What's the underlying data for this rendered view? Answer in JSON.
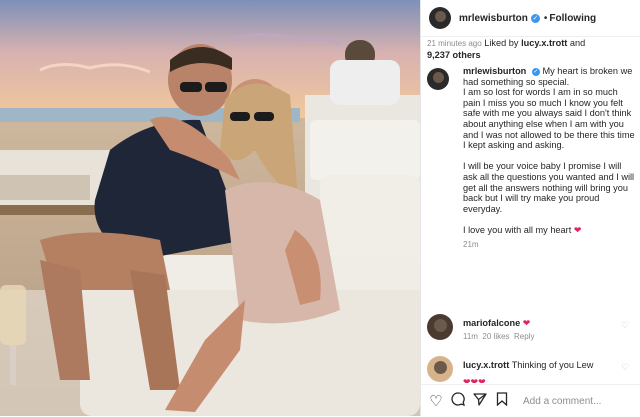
{
  "post": {
    "username": "mrlewisburton",
    "verified_mark": "✓",
    "follow_separator": "•",
    "follow_label": "Following",
    "time_ago": "21 minutes ago",
    "liked_by_prefix": "Liked by",
    "liked_by_user": "lucy.x.trott",
    "liked_by_suffix": "and",
    "liked_by_count": "9,237 others"
  },
  "caption": {
    "username": "mrlewisburton",
    "para1": "My heart is broken we had something so special.",
    "para2": "I am so lost for words I am in so much pain I miss you so much I know you felt safe with me you always said I don't think about anything else when I am with you and I was not allowed to be there this time I kept asking and asking.",
    "para3": "I will be your voice baby I promise I will ask all the questions you wanted and I will get all the answers nothing will bring you back but I will try make you proud everyday.",
    "para4": "I love you with all my heart",
    "time": "21m"
  },
  "comments": [
    {
      "username": "mariofalcone",
      "text": "",
      "time": "11m",
      "likes": "20 likes",
      "reply": "Reply"
    },
    {
      "username": "lucy.x.trott",
      "text": "Thinking of you Lew"
    }
  ],
  "actions": {
    "add_comment_placeholder": "Add a comment..."
  },
  "icons": [
    "heart-icon",
    "comment-icon",
    "share-icon",
    "bookmark-icon",
    "verified-icon",
    "emoji-icon"
  ],
  "colors": {
    "verified": "#3897f0",
    "heart": "#e0245e",
    "text": "#262626",
    "muted": "#8e8e8e"
  }
}
